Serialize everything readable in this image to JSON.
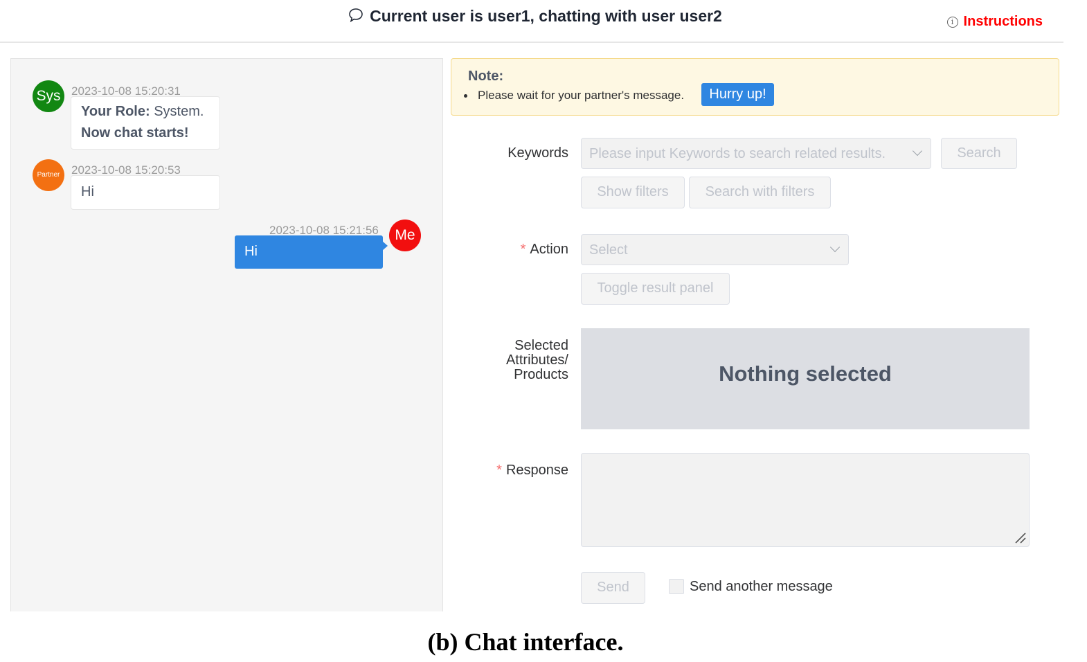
{
  "header": {
    "title": "Current user is user1, chatting with user user2",
    "instructions_label": "Instructions"
  },
  "chat": {
    "messages": [
      {
        "avatar": "Sys",
        "avatar_color": "#128712",
        "time": "2023-10-08 15:20:31",
        "role_prefix": "Your Role:",
        "role_value": "System.",
        "line2": "Now chat starts!"
      },
      {
        "avatar": "Partner",
        "avatar_color": "#f37012",
        "time": "2023-10-08 15:20:53",
        "text": "Hi"
      },
      {
        "avatar": "Me",
        "avatar_color": "#f20f0f",
        "time": "2023-10-08 15:21:56",
        "text": "Hi"
      }
    ]
  },
  "note": {
    "title": "Note:",
    "text": "Please wait for your partner's message.",
    "hurry_label": "Hurry up!"
  },
  "form": {
    "keywords_label": "Keywords",
    "keywords_placeholder": "Please input Keywords to search related results.",
    "search_label": "Search",
    "show_filters_label": "Show filters",
    "search_with_filters_label": "Search with filters",
    "action_label": "Action",
    "action_placeholder": "Select",
    "toggle_label": "Toggle result panel",
    "selected_label_1": "Selected",
    "selected_label_2": "Attributes/",
    "selected_label_3": "Products",
    "nothing_selected": "Nothing selected",
    "response_label": "Response",
    "response_value": "",
    "send_label": "Send",
    "send_another_label": "Send another message"
  },
  "caption": "(b) Chat interface.",
  "colors": {
    "accent": "#2f86e1",
    "required": "#f56c6c",
    "danger": "#ff0000"
  }
}
